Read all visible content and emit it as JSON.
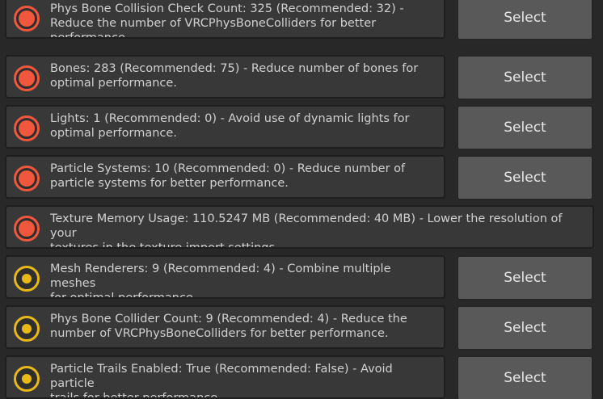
{
  "rows": [
    {
      "level": "error",
      "message": "Phys Bone Collision Check Count: 325 (Recommended: 32) -\nReduce the number of VRCPhysBoneColliders for better\nperformance.",
      "button": "Select"
    },
    {
      "level": "error",
      "message": "Bones: 283 (Recommended: 75) - Reduce number of bones for\noptimal performance.",
      "button": "Select"
    },
    {
      "level": "error",
      "message": "Lights: 1 (Recommended: 0) - Avoid use of dynamic lights for\noptimal performance.",
      "button": "Select"
    },
    {
      "level": "error",
      "message": "Particle Systems: 10 (Recommended: 0) - Reduce number of\nparticle systems for better performance.",
      "button": "Select"
    },
    {
      "level": "error",
      "message": "Texture Memory Usage: 110.5247 MB (Recommended: 40 MB) - Lower the resolution of your\ntextures in the texture import settings."
    },
    {
      "level": "warning",
      "message": "Mesh Renderers: 9 (Recommended: 4) - Combine multiple meshes\nfor optimal performance.",
      "button": "Select"
    },
    {
      "level": "warning",
      "message": "Phys Bone Collider Count: 9 (Recommended: 4) - Reduce the\nnumber of VRCPhysBoneColliders for better performance.",
      "button": "Select"
    },
    {
      "level": "warning",
      "message": "Particle Trails Enabled: True (Recommended: False) - Avoid particle\ntrails for better performance.",
      "button": "Select"
    }
  ],
  "colors": {
    "error": "#f0573c",
    "warning": "#e8b817"
  }
}
